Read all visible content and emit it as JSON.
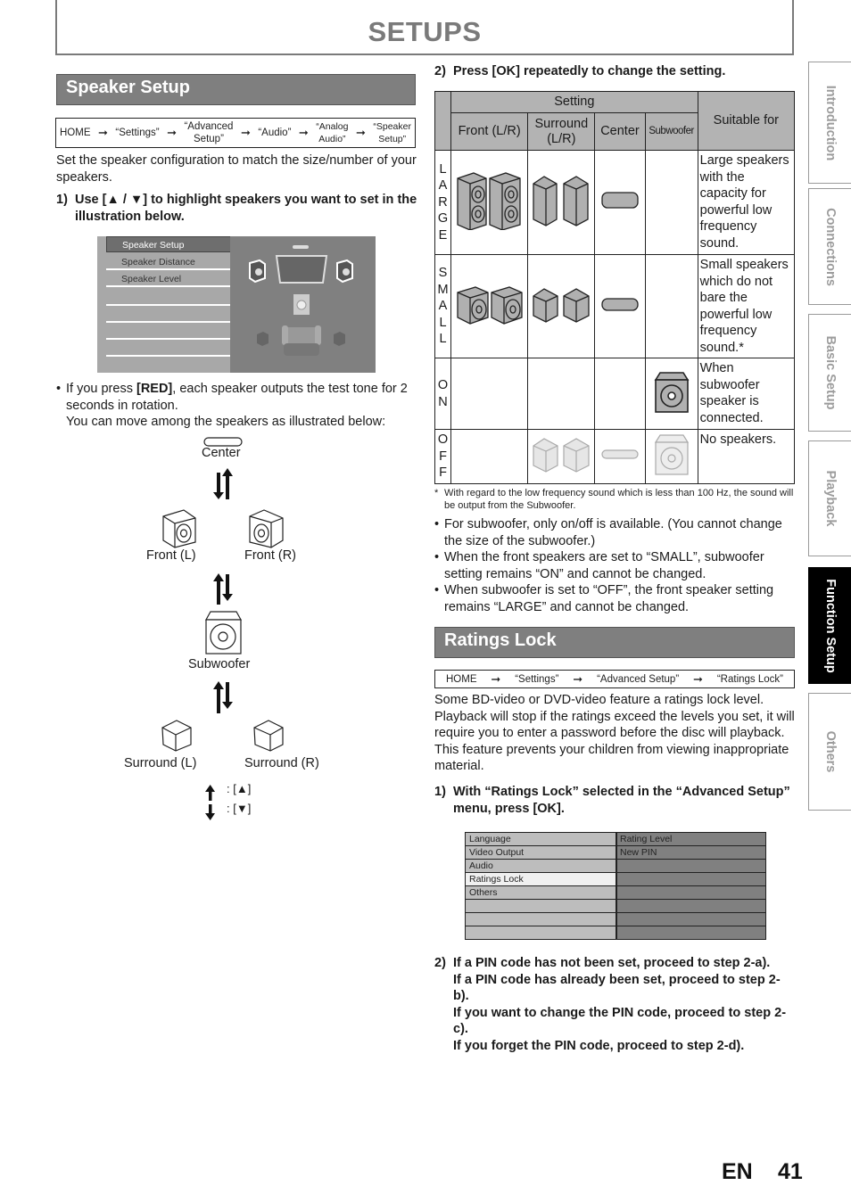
{
  "page": {
    "title": "SETUPS",
    "language": "EN",
    "number": "41"
  },
  "side_tabs": [
    {
      "label": "Introduction",
      "active": false
    },
    {
      "label": "Connections",
      "active": false
    },
    {
      "label": "Basic Setup",
      "active": false
    },
    {
      "label": "Playback",
      "active": false
    },
    {
      "label": "Function Setup",
      "active": true
    },
    {
      "label": "Others",
      "active": false
    }
  ],
  "speaker_setup": {
    "heading": "Speaker Setup",
    "path": [
      "HOME",
      "“Settings”",
      "“Advanced\nSetup”",
      "“Audio”",
      "“Analog\nAudio”",
      "“Speaker\nSetup”"
    ],
    "path_arrow": "➞",
    "intro": "Set the speaker configuration to match the size/number of your speakers.",
    "step1_num": "1)",
    "step1_text": "Use [▲ / ▼] to highlight speakers you want to set in the illustration below.",
    "menu_items": [
      "Speaker Setup",
      "Speaker Distance",
      "Speaker Level"
    ],
    "menu_selected": "Speaker Setup",
    "bullet_pre": "If you press ",
    "bullet_bold": "[RED]",
    "bullet_post": ", each speaker outputs the test tone for 2 seconds in rotation.",
    "bullet_line2": "You can move among the speakers as illustrated below:",
    "flow": {
      "center": "Center",
      "front_l": "Front (L)",
      "front_r": "Front (R)",
      "subwoofer": "Subwoofer",
      "surround_l": "Surround (L)",
      "surround_r": "Surround (R)",
      "legend_up": ": [▲]",
      "legend_down": ": [▼]"
    },
    "step2_num": "2)",
    "step2_text": "Press [OK] repeatedly to change the setting.",
    "table": {
      "header_setting": "Setting",
      "header_suitable": "Suitable for",
      "columns": [
        "Front (L/R)",
        "Surround\n(L/R)",
        "Center",
        "Subwoofer"
      ],
      "rows": [
        {
          "label": "L\nA\nR\nG\nE",
          "icons": [
            "large-front-speakers",
            "large-surround-speakers",
            "center-speaker",
            ""
          ],
          "suitable": "Large speakers with the capacity for powerful low frequency sound."
        },
        {
          "label": "S\nM\nA\nL\nL",
          "icons": [
            "small-front-speakers",
            "small-surround-speakers",
            "center-speaker",
            ""
          ],
          "suitable": "Small speakers which do not bare the powerful low frequency sound.*"
        },
        {
          "label": "O\nN",
          "icons": [
            "",
            "",
            "",
            "subwoofer"
          ],
          "suitable": "When subwoofer speaker is connected."
        },
        {
          "label": "O\nF\nF",
          "icons": [
            "",
            "surround-off",
            "center-off",
            "subwoofer-off"
          ],
          "suitable": "No speakers."
        }
      ]
    },
    "footnote_mark": "*",
    "footnote": "With regard to the low frequency sound which is less than 100 Hz, the sound will be output from the Subwoofer.",
    "notes": [
      "For subwoofer, only on/off is available. (You cannot change the size of the subwoofer.)",
      "When the front speakers are set to “SMALL”, subwoofer setting remains “ON” and cannot be changed.",
      "When subwoofer is set to “OFF”, the front speaker setting remains “LARGE” and cannot be changed."
    ]
  },
  "ratings_lock": {
    "heading": "Ratings Lock",
    "path": [
      "HOME",
      "“Settings”",
      "“Advanced Setup”",
      "“Ratings Lock”"
    ],
    "path_arrow": "➞",
    "intro": "Some BD-video or DVD-video feature a ratings lock level. Playback will stop if the ratings exceed the levels you set, it will require you to enter a password before the disc will playback. This feature prevents your children from viewing inappropriate material.",
    "step1_num": "1)",
    "step1_text": "With “Ratings Lock” selected in the “Advanced Setup” menu, press [OK].",
    "menu_left": [
      "Language",
      "Video Output",
      "Audio",
      "Ratings Lock",
      "Others",
      "",
      "",
      ""
    ],
    "menu_right": [
      "Rating Level",
      "New PIN",
      "",
      "",
      "",
      "",
      "",
      ""
    ],
    "menu_selected": "Ratings Lock",
    "step2_num": "2)",
    "step2_lines": [
      "If a PIN code has not been set, proceed to step 2-a).",
      "If a PIN code has already been set, proceed to step 2-b).",
      "If you want to change the PIN code, proceed to step 2-c).",
      "If you forget the PIN code, proceed to step 2-d)."
    ]
  }
}
